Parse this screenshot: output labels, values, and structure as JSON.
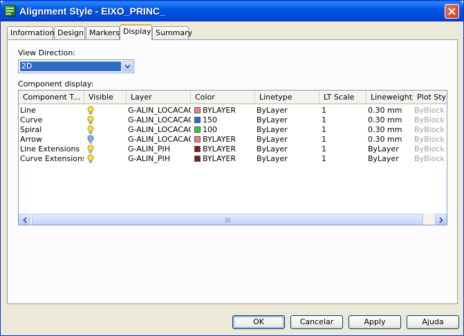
{
  "window": {
    "title": "Alignment Style - EIXO_PRINC_"
  },
  "tabs": [
    {
      "label": "Information"
    },
    {
      "label": "Design"
    },
    {
      "label": "Markers"
    },
    {
      "label": "Display"
    },
    {
      "label": "Summary"
    }
  ],
  "active_tab": "Display",
  "view_direction": {
    "label": "View Direction:",
    "value": "2D"
  },
  "component_display": {
    "label": "Component display:",
    "columns": [
      "Component T...",
      "Visible",
      "Layer",
      "Color",
      "Linetype",
      "LT Scale",
      "Lineweight",
      "Plot Style"
    ],
    "rows": [
      {
        "component": "Line",
        "visible": "on",
        "layer": "G-ALIN_LOCACAO",
        "color": "BYLAYER",
        "color_swatch": "#f08080",
        "linetype": "ByLayer",
        "lt_scale": "1",
        "lineweight": "0.30 mm",
        "plot_style": "ByBlock"
      },
      {
        "component": "Curve",
        "visible": "on",
        "layer": "G-ALIN_LOCACAO",
        "color": "150",
        "color_swatch": "#1e6fd9",
        "linetype": "ByLayer",
        "lt_scale": "1",
        "lineweight": "0.30 mm",
        "plot_style": "ByBlock"
      },
      {
        "component": "Spiral",
        "visible": "on",
        "layer": "G-ALIN_LOCACAO",
        "color": "100",
        "color_swatch": "#2ecc40",
        "linetype": "ByLayer",
        "lt_scale": "1",
        "lineweight": "0.30 mm",
        "plot_style": "ByBlock"
      },
      {
        "component": "Arrow",
        "visible": "off",
        "layer": "G-ALIN_LOCACAO",
        "color": "BYLAYER",
        "color_swatch": "#f08080",
        "linetype": "ByLayer",
        "lt_scale": "1",
        "lineweight": "0.30 mm",
        "plot_style": "ByBlock"
      },
      {
        "component": "Line Extensions",
        "visible": "on",
        "layer": "G-ALIN_PIH",
        "color": "BYLAYER",
        "color_swatch": "#8b1a1a",
        "linetype": "ByLayer",
        "lt_scale": "1",
        "lineweight": "ByLayer",
        "plot_style": "ByBlock"
      },
      {
        "component": "Curve Extensions",
        "visible": "on",
        "layer": "G-ALIN_PIH",
        "color": "BYLAYER",
        "color_swatch": "#8b1a1a",
        "linetype": "ByLayer",
        "lt_scale": "1",
        "lineweight": "ByLayer",
        "plot_style": "ByBlock"
      }
    ]
  },
  "scrollbar": {
    "grip": "III"
  },
  "buttons": {
    "ok": "OK",
    "cancel": "Cancelar",
    "apply": "Apply",
    "help": "Ajuda"
  },
  "colors": {
    "titlebar": "#0055e5",
    "selection": "#316ac5",
    "active_tab_accent": "#f6a633",
    "bulb_on": "#ffe14d",
    "bulb_off": "#7fb2e5"
  }
}
